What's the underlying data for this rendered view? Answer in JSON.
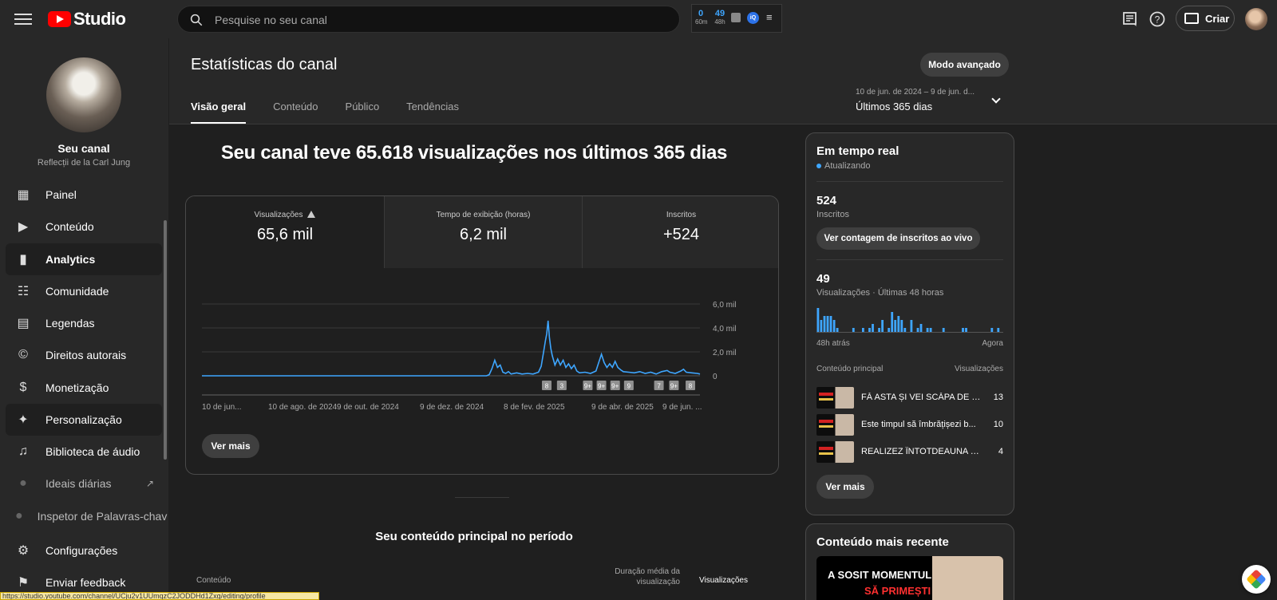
{
  "topbar": {
    "brand": "Studio",
    "search_placeholder": "Pesquise no seu canal",
    "ext_stats": [
      {
        "value": "0",
        "label": "60m"
      },
      {
        "value": "49",
        "label": "48h"
      }
    ],
    "ext_badge": "iQ",
    "create_label": "Criar"
  },
  "sidebar": {
    "channel_name": "Seu canal",
    "channel_sub": "Reflecții de la Carl Jung",
    "items": [
      {
        "label": "Painel",
        "icon": "dashboard-icon",
        "glyph": "▦"
      },
      {
        "label": "Conteúdo",
        "icon": "content-icon",
        "glyph": "▶"
      },
      {
        "label": "Analytics",
        "icon": "analytics-icon",
        "glyph": "▮"
      },
      {
        "label": "Comunidade",
        "icon": "community-icon",
        "glyph": "☷"
      },
      {
        "label": "Legendas",
        "icon": "subtitles-icon",
        "glyph": "▤"
      },
      {
        "label": "Direitos autorais",
        "icon": "copyright-icon",
        "glyph": "©"
      },
      {
        "label": "Monetização",
        "icon": "monetization-icon",
        "glyph": "$"
      },
      {
        "label": "Personalização",
        "icon": "customization-icon",
        "glyph": "✦"
      },
      {
        "label": "Biblioteca de áudio",
        "icon": "audio-library-icon",
        "glyph": "♫"
      },
      {
        "label": "Ideais diárias",
        "icon": "vidiq-icon",
        "glyph": "●"
      },
      {
        "label": "Inspetor de Palavras-chav",
        "icon": "vidiq-icon",
        "glyph": "●"
      }
    ],
    "bottom": [
      {
        "label": "Configurações",
        "icon": "gear-icon",
        "glyph": "⚙"
      },
      {
        "label": "Enviar feedback",
        "icon": "feedback-icon",
        "glyph": "⚑"
      }
    ]
  },
  "header": {
    "title": "Estatísticas do canal",
    "advanced_mode": "Modo avançado",
    "tabs": [
      "Visão geral",
      "Conteúdo",
      "Público",
      "Tendências"
    ],
    "range_dates": "10 de jun. de 2024 – 9 de jun. d...",
    "range_label": "Últimos 365 dias"
  },
  "overview": {
    "headline": "Seu canal teve 65.618 visualizações nos últimos 365 dias",
    "kpis": [
      {
        "label": "Visualizações",
        "value": "65,6 mil"
      },
      {
        "label": "Tempo de exibição (horas)",
        "value": "6,2 mil"
      },
      {
        "label": "Inscritos",
        "value": "+524"
      }
    ],
    "see_more": "Ver mais",
    "top_content_title": "Seu conteúdo principal no período",
    "table_headers": [
      "Conteúdo",
      "Duração média da visualização",
      "Visualizações"
    ]
  },
  "chart_data": {
    "type": "line",
    "x_tick_labels": [
      "10 de jun...",
      "10 de ago. de 2024",
      "9 de out. de 2024",
      "9 de dez. de 2024",
      "8 de fev. de 2025",
      "9 de abr. de 2025",
      "9 de jun. ..."
    ],
    "y_tick_labels": [
      "6,0 mil",
      "4,0 mil",
      "2,0 mil",
      "0"
    ],
    "ylim": [
      0,
      6000
    ],
    "x_domain_days": [
      0,
      364
    ],
    "series": [
      {
        "color": "#3ea6ff",
        "points": [
          [
            0,
            0
          ],
          [
            208,
            0
          ],
          [
            210,
            100
          ],
          [
            212,
            600
          ],
          [
            214,
            1300
          ],
          [
            216,
            700
          ],
          [
            218,
            900
          ],
          [
            220,
            300
          ],
          [
            222,
            200
          ],
          [
            224,
            350
          ],
          [
            226,
            150
          ],
          [
            230,
            250
          ],
          [
            234,
            150
          ],
          [
            238,
            200
          ],
          [
            242,
            150
          ],
          [
            246,
            300
          ],
          [
            248,
            800
          ],
          [
            250,
            2200
          ],
          [
            251,
            2900
          ],
          [
            252,
            3500
          ],
          [
            253,
            4600
          ],
          [
            254,
            3200
          ],
          [
            255,
            2300
          ],
          [
            256,
            1700
          ],
          [
            258,
            900
          ],
          [
            260,
            1400
          ],
          [
            262,
            900
          ],
          [
            264,
            1300
          ],
          [
            266,
            700
          ],
          [
            268,
            1000
          ],
          [
            270,
            600
          ],
          [
            272,
            900
          ],
          [
            274,
            400
          ],
          [
            276,
            250
          ],
          [
            280,
            300
          ],
          [
            284,
            200
          ],
          [
            288,
            400
          ],
          [
            290,
            1100
          ],
          [
            292,
            1800
          ],
          [
            294,
            1100
          ],
          [
            296,
            700
          ],
          [
            298,
            1000
          ],
          [
            300,
            700
          ],
          [
            302,
            1200
          ],
          [
            304,
            700
          ],
          [
            306,
            500
          ],
          [
            308,
            350
          ],
          [
            312,
            300
          ],
          [
            316,
            250
          ],
          [
            320,
            350
          ],
          [
            324,
            200
          ],
          [
            328,
            300
          ],
          [
            332,
            150
          ],
          [
            336,
            350
          ],
          [
            340,
            450
          ],
          [
            342,
            300
          ],
          [
            346,
            200
          ],
          [
            350,
            400
          ],
          [
            352,
            550
          ],
          [
            354,
            300
          ],
          [
            358,
            250
          ],
          [
            362,
            200
          ],
          [
            364,
            150
          ]
        ]
      }
    ],
    "annotations": [
      {
        "x": 252,
        "label": "8"
      },
      {
        "x": 263,
        "label": "3"
      },
      {
        "x": 282,
        "label": "9+"
      },
      {
        "x": 292,
        "label": "9+"
      },
      {
        "x": 302,
        "label": "9+"
      },
      {
        "x": 312,
        "label": "9"
      },
      {
        "x": 334,
        "label": "7"
      },
      {
        "x": 345,
        "label": "9+"
      },
      {
        "x": 357,
        "label": "8"
      }
    ],
    "grid": true
  },
  "realtime": {
    "title": "Em tempo real",
    "status": "Atualizando",
    "subs_value": "524",
    "subs_label": "Inscritos",
    "live_button": "Ver contagem de inscritos ao vivo",
    "views_value": "49",
    "views_label": "Visualizações · Últimas 48 horas",
    "axis_start": "48h atrás",
    "axis_end": "Agora",
    "hourly_views": [
      6,
      3,
      4,
      4,
      4,
      3,
      1,
      0,
      0,
      0,
      0,
      1,
      0,
      0,
      1,
      0,
      1,
      2,
      0,
      1,
      3,
      0,
      1,
      5,
      3,
      4,
      3,
      1,
      0,
      3,
      0,
      1,
      2,
      0,
      1,
      1,
      0,
      0,
      0,
      1,
      0,
      0,
      0,
      0,
      0,
      1,
      1,
      0,
      0,
      0,
      0,
      0,
      0,
      0,
      1,
      0,
      1,
      0
    ],
    "top_content_label": "Conteúdo principal",
    "top_views_label": "Visualizações",
    "rows": [
      {
        "title": "FĂ ASTA ȘI VEI SCĂPA DE 9...",
        "views": "13"
      },
      {
        "title": "Este timpul să îmbrățișezi b...",
        "views": "10"
      },
      {
        "title": "REALIZEZ ÎNTOTDEAUNA cee...",
        "views": "4"
      }
    ],
    "see_more": "Ver mais"
  },
  "recent": {
    "title": "Conteúdo mais recente",
    "thumb_line1": "A SOSIT MOMENTUL",
    "thumb_line2": "SĂ PRIMEȘTI"
  },
  "status_url": "https://studio.youtube.com/channel/UCju2v1UUmqzC2JODDHd1Zxg/editing/profile",
  "colors": {
    "accent": "#3ea6ff",
    "brand": "#ff0000"
  }
}
